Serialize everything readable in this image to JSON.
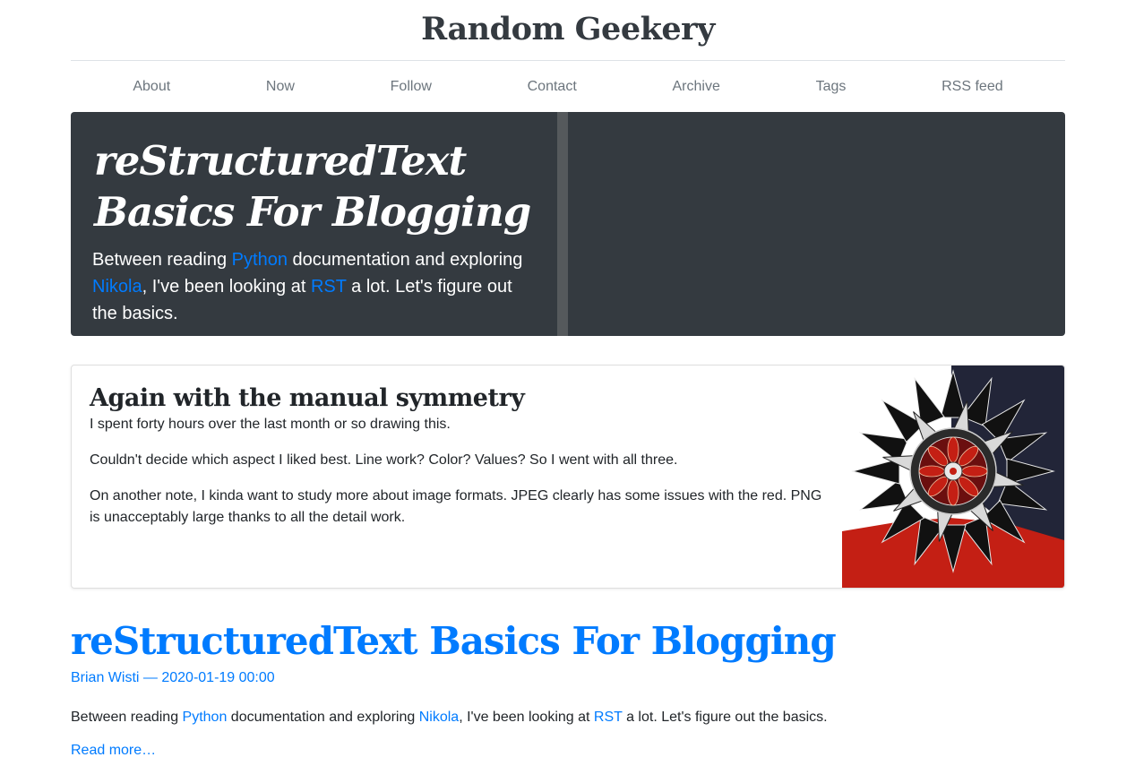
{
  "site": {
    "title": "Random Geekery"
  },
  "nav": {
    "items": [
      {
        "label": "About"
      },
      {
        "label": "Now"
      },
      {
        "label": "Follow"
      },
      {
        "label": "Contact"
      },
      {
        "label": "Archive"
      },
      {
        "label": "Tags"
      },
      {
        "label": "RSS feed"
      }
    ]
  },
  "featured": {
    "title": "reStructuredText Basics For Blogging",
    "summary": {
      "t1": "Between reading ",
      "link1": "Python",
      "t2": " documentation and exploring ",
      "link2": "Nikola",
      "t3": ", I've been looking at ",
      "link3": "RST",
      "t4": " a lot. Let's figure out the basics."
    }
  },
  "card": {
    "title": "Again with the manual symmetry",
    "paragraphs": [
      "I spent forty hours over the last month or so drawing this.",
      "Couldn't decide which aspect I liked best. Line work? Color? Values? So I went with all three.",
      "On another note, I kinda want to study more about image formats. JPEG clearly has some issues with the red. PNG is unacceptably large thanks to all the detail work."
    ]
  },
  "post": {
    "title": "reStructuredText Basics For Blogging",
    "author": "Brian Wisti",
    "separator": " — ",
    "date": "2020-01-19 00:00",
    "summary": {
      "t1": "Between reading ",
      "link1": "Python",
      "t2": " documentation and exploring ",
      "link2": "Nikola",
      "t3": ", I've been looking at ",
      "link3": "RST",
      "t4": " a lot. Let's figure out the basics."
    },
    "read_more": "Read more…"
  },
  "colors": {
    "link": "#007bff",
    "jumbotron_bg": "#343a40",
    "art_bg": "#222538",
    "art_red": "#c41f14"
  }
}
